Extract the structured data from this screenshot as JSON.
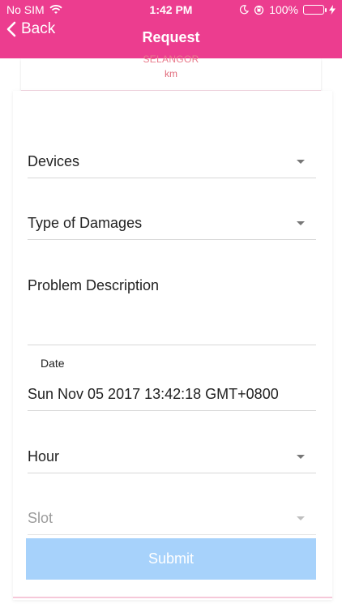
{
  "status_bar": {
    "carrier": "No SIM",
    "time": "1:42 PM",
    "battery_percent": "100%",
    "battery_level": 1.0,
    "icons": [
      "wifi-icon",
      "moon-icon",
      "rotation-lock-icon",
      "battery-icon",
      "charging-icon"
    ]
  },
  "navbar": {
    "back_label": "Back",
    "title": "Request",
    "background_color": "#ec3d8f"
  },
  "card": {
    "state": "SELANGOR",
    "unit": "km"
  },
  "form": {
    "devices_placeholder": "Devices",
    "damage_placeholder": "Type of Damages",
    "description_placeholder": "Problem Description",
    "date_label": "Date",
    "date_value": "Sun Nov 05 2017 13:42:18 GMT+0800",
    "hour_placeholder": "Hour",
    "slot_placeholder": "Slot",
    "submit_label": "Submit",
    "submit_color": "#a7d2fb"
  }
}
